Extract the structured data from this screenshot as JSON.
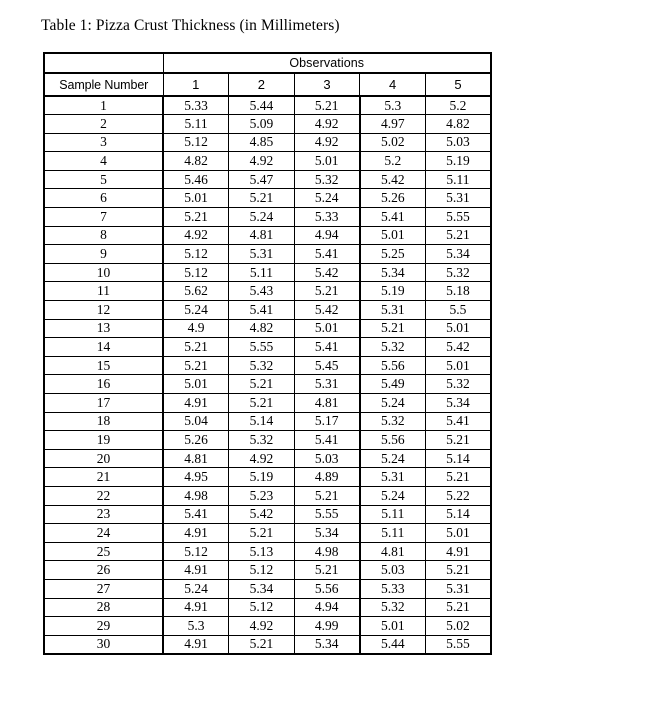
{
  "document": {
    "caption": "Table 1: Pizza Crust Thickness (in Millimeters)",
    "background_color": "#ffffff",
    "text_color": "#000000",
    "border_color": "#000000"
  },
  "table": {
    "group_header": "Observations",
    "row_header_label": "Sample Number",
    "observation_columns": [
      "1",
      "2",
      "3",
      "4",
      "5"
    ],
    "rows": [
      {
        "sample": "1",
        "values": [
          "5.33",
          "5.44",
          "5.21",
          "5.3",
          "5.2"
        ]
      },
      {
        "sample": "2",
        "values": [
          "5.11",
          "5.09",
          "4.92",
          "4.97",
          "4.82"
        ]
      },
      {
        "sample": "3",
        "values": [
          "5.12",
          "4.85",
          "4.92",
          "5.02",
          "5.03"
        ]
      },
      {
        "sample": "4",
        "values": [
          "4.82",
          "4.92",
          "5.01",
          "5.2",
          "5.19"
        ]
      },
      {
        "sample": "5",
        "values": [
          "5.46",
          "5.47",
          "5.32",
          "5.42",
          "5.11"
        ]
      },
      {
        "sample": "6",
        "values": [
          "5.01",
          "5.21",
          "5.24",
          "5.26",
          "5.31"
        ]
      },
      {
        "sample": "7",
        "values": [
          "5.21",
          "5.24",
          "5.33",
          "5.41",
          "5.55"
        ]
      },
      {
        "sample": "8",
        "values": [
          "4.92",
          "4.81",
          "4.94",
          "5.01",
          "5.21"
        ]
      },
      {
        "sample": "9",
        "values": [
          "5.12",
          "5.31",
          "5.41",
          "5.25",
          "5.34"
        ]
      },
      {
        "sample": "10",
        "values": [
          "5.12",
          "5.11",
          "5.42",
          "5.34",
          "5.32"
        ]
      },
      {
        "sample": "11",
        "values": [
          "5.62",
          "5.43",
          "5.21",
          "5.19",
          "5.18"
        ]
      },
      {
        "sample": "12",
        "values": [
          "5.24",
          "5.41",
          "5.42",
          "5.31",
          "5.5"
        ]
      },
      {
        "sample": "13",
        "values": [
          "4.9",
          "4.82",
          "5.01",
          "5.21",
          "5.01"
        ]
      },
      {
        "sample": "14",
        "values": [
          "5.21",
          "5.55",
          "5.41",
          "5.32",
          "5.42"
        ]
      },
      {
        "sample": "15",
        "values": [
          "5.21",
          "5.32",
          "5.45",
          "5.56",
          "5.01"
        ]
      },
      {
        "sample": "16",
        "values": [
          "5.01",
          "5.21",
          "5.31",
          "5.49",
          "5.32"
        ]
      },
      {
        "sample": "17",
        "values": [
          "4.91",
          "5.21",
          "4.81",
          "5.24",
          "5.34"
        ]
      },
      {
        "sample": "18",
        "values": [
          "5.04",
          "5.14",
          "5.17",
          "5.32",
          "5.41"
        ]
      },
      {
        "sample": "19",
        "values": [
          "5.26",
          "5.32",
          "5.41",
          "5.56",
          "5.21"
        ]
      },
      {
        "sample": "20",
        "values": [
          "4.81",
          "4.92",
          "5.03",
          "5.24",
          "5.14"
        ]
      },
      {
        "sample": "21",
        "values": [
          "4.95",
          "5.19",
          "4.89",
          "5.31",
          "5.21"
        ]
      },
      {
        "sample": "22",
        "values": [
          "4.98",
          "5.23",
          "5.21",
          "5.24",
          "5.22"
        ]
      },
      {
        "sample": "23",
        "values": [
          "5.41",
          "5.42",
          "5.55",
          "5.11",
          "5.14"
        ]
      },
      {
        "sample": "24",
        "values": [
          "4.91",
          "5.21",
          "5.34",
          "5.11",
          "5.01"
        ]
      },
      {
        "sample": "25",
        "values": [
          "5.12",
          "5.13",
          "4.98",
          "4.81",
          "4.91"
        ]
      },
      {
        "sample": "26",
        "values": [
          "4.91",
          "5.12",
          "5.21",
          "5.03",
          "5.21"
        ]
      },
      {
        "sample": "27",
        "values": [
          "5.24",
          "5.34",
          "5.56",
          "5.33",
          "5.31"
        ]
      },
      {
        "sample": "28",
        "values": [
          "4.91",
          "5.12",
          "4.94",
          "5.32",
          "5.21"
        ]
      },
      {
        "sample": "29",
        "values": [
          "5.3",
          "4.92",
          "4.99",
          "5.01",
          "5.02"
        ]
      },
      {
        "sample": "30",
        "values": [
          "4.91",
          "5.21",
          "5.34",
          "5.44",
          "5.55"
        ]
      }
    ]
  },
  "chart_data": {
    "type": "table",
    "title": "Table 1: Pizza Crust Thickness (in Millimeters)",
    "xlabel": "Observations",
    "ylabel": "Sample Number",
    "categories": [
      "1",
      "2",
      "3",
      "4",
      "5"
    ],
    "series": [
      {
        "name": "1",
        "values": [
          5.33,
          5.44,
          5.21,
          5.3,
          5.2
        ]
      },
      {
        "name": "2",
        "values": [
          5.11,
          5.09,
          4.92,
          4.97,
          4.82
        ]
      },
      {
        "name": "3",
        "values": [
          5.12,
          4.85,
          4.92,
          5.02,
          5.03
        ]
      },
      {
        "name": "4",
        "values": [
          4.82,
          4.92,
          5.01,
          5.2,
          5.19
        ]
      },
      {
        "name": "5",
        "values": [
          5.46,
          5.47,
          5.32,
          5.42,
          5.11
        ]
      },
      {
        "name": "6",
        "values": [
          5.01,
          5.21,
          5.24,
          5.26,
          5.31
        ]
      },
      {
        "name": "7",
        "values": [
          5.21,
          5.24,
          5.33,
          5.41,
          5.55
        ]
      },
      {
        "name": "8",
        "values": [
          4.92,
          4.81,
          4.94,
          5.01,
          5.21
        ]
      },
      {
        "name": "9",
        "values": [
          5.12,
          5.31,
          5.41,
          5.25,
          5.34
        ]
      },
      {
        "name": "10",
        "values": [
          5.12,
          5.11,
          5.42,
          5.34,
          5.32
        ]
      },
      {
        "name": "11",
        "values": [
          5.62,
          5.43,
          5.21,
          5.19,
          5.18
        ]
      },
      {
        "name": "12",
        "values": [
          5.24,
          5.41,
          5.42,
          5.31,
          5.5
        ]
      },
      {
        "name": "13",
        "values": [
          4.9,
          4.82,
          5.01,
          5.21,
          5.01
        ]
      },
      {
        "name": "14",
        "values": [
          5.21,
          5.55,
          5.41,
          5.32,
          5.42
        ]
      },
      {
        "name": "15",
        "values": [
          5.21,
          5.32,
          5.45,
          5.56,
          5.01
        ]
      },
      {
        "name": "16",
        "values": [
          5.01,
          5.21,
          5.31,
          5.49,
          5.32
        ]
      },
      {
        "name": "17",
        "values": [
          4.91,
          5.21,
          4.81,
          5.24,
          5.34
        ]
      },
      {
        "name": "18",
        "values": [
          5.04,
          5.14,
          5.17,
          5.32,
          5.41
        ]
      },
      {
        "name": "19",
        "values": [
          5.26,
          5.32,
          5.41,
          5.56,
          5.21
        ]
      },
      {
        "name": "20",
        "values": [
          4.81,
          4.92,
          5.03,
          5.24,
          5.14
        ]
      },
      {
        "name": "21",
        "values": [
          4.95,
          5.19,
          4.89,
          5.31,
          5.21
        ]
      },
      {
        "name": "22",
        "values": [
          4.98,
          5.23,
          5.21,
          5.24,
          5.22
        ]
      },
      {
        "name": "23",
        "values": [
          5.41,
          5.42,
          5.55,
          5.11,
          5.14
        ]
      },
      {
        "name": "24",
        "values": [
          4.91,
          5.21,
          5.34,
          5.11,
          5.01
        ]
      },
      {
        "name": "25",
        "values": [
          5.12,
          5.13,
          4.98,
          4.81,
          4.91
        ]
      },
      {
        "name": "26",
        "values": [
          4.91,
          5.12,
          5.21,
          5.03,
          5.21
        ]
      },
      {
        "name": "27",
        "values": [
          5.24,
          5.34,
          5.56,
          5.33,
          5.31
        ]
      },
      {
        "name": "28",
        "values": [
          4.91,
          5.12,
          4.94,
          5.32,
          5.21
        ]
      },
      {
        "name": "29",
        "values": [
          5.3,
          4.92,
          4.99,
          5.01,
          5.02
        ]
      },
      {
        "name": "30",
        "values": [
          4.91,
          5.21,
          5.34,
          5.44,
          5.55
        ]
      }
    ],
    "units": "millimeters",
    "grid": true,
    "legend": "none"
  }
}
